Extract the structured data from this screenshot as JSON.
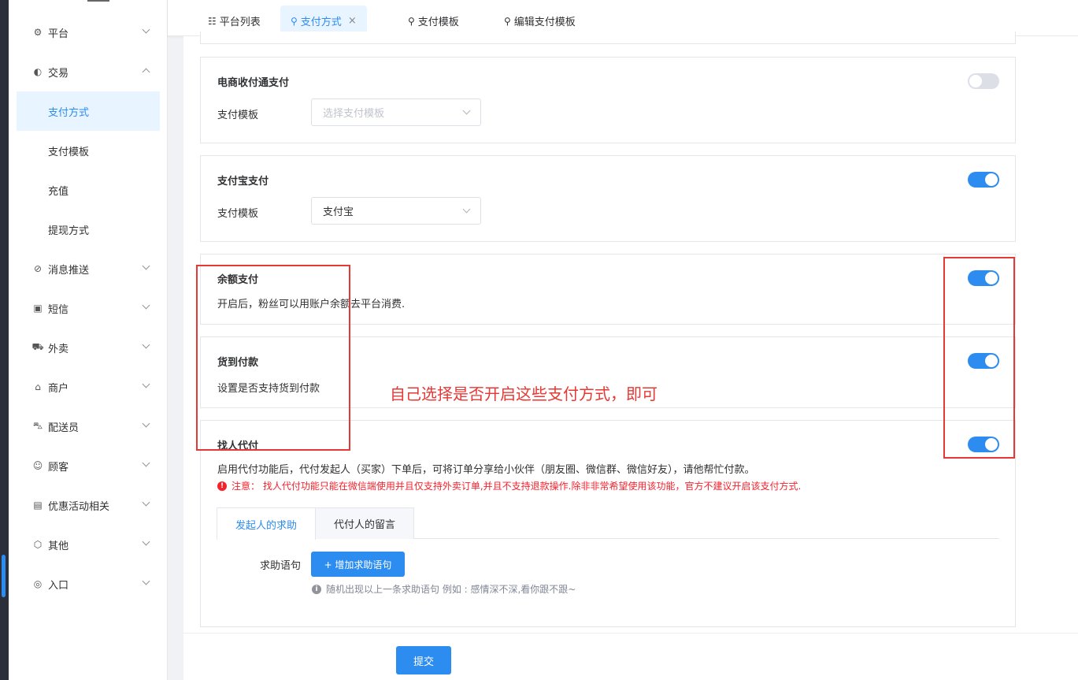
{
  "sidebar": {
    "items": [
      {
        "label": "平台",
        "icon": "gear-icon",
        "expanded": false
      },
      {
        "label": "交易",
        "icon": "wallet-icon",
        "expanded": true,
        "children": [
          "支付方式",
          "支付模板",
          "充值",
          "提现方式"
        ],
        "active_child": "支付方式"
      },
      {
        "label": "消息推送",
        "icon": "bell-off-icon",
        "expanded": false
      },
      {
        "label": "短信",
        "icon": "chat-icon",
        "expanded": false
      },
      {
        "label": "外卖",
        "icon": "scooter-icon",
        "expanded": false
      },
      {
        "label": "商户",
        "icon": "store-icon",
        "expanded": false
      },
      {
        "label": "配送员",
        "icon": "delivery-icon",
        "expanded": false
      },
      {
        "label": "顾客",
        "icon": "user-circle-icon",
        "expanded": false
      },
      {
        "label": "优惠活动相关",
        "icon": "gift-icon",
        "expanded": false
      },
      {
        "label": "其他",
        "icon": "hexagon-icon",
        "expanded": false
      },
      {
        "label": "入口",
        "icon": "compass-icon",
        "expanded": false
      }
    ]
  },
  "tabs": [
    {
      "label": "平台列表",
      "icon": "list-icon",
      "active": false
    },
    {
      "label": "支付方式",
      "icon": "user-gear-icon",
      "active": true,
      "closable": true,
      "close_glyph": "×"
    },
    {
      "label": "支付模板",
      "icon": "user-gear-icon",
      "active": false
    },
    {
      "label": "编辑支付模板",
      "icon": "user-gear-icon",
      "active": false
    }
  ],
  "cards": {
    "ecommerce": {
      "title": "电商收付通支付",
      "template_label": "支付模板",
      "select_placeholder": "选择支付模板",
      "enabled": false
    },
    "alipay": {
      "title": "支付宝支付",
      "template_label": "支付模板",
      "select_value": "支付宝",
      "enabled": true
    },
    "balance": {
      "title": "余额支付",
      "desc": "开启后，粉丝可以用账户余额去平台消费.",
      "enabled": true
    },
    "cod": {
      "title": "货到付款",
      "desc": "设置是否支持货到付款",
      "enabled": true
    },
    "proxy": {
      "title": "找人代付",
      "desc": "启用代付功能后，代付发起人（买家）下单后，可将订单分享给小伙伴（朋友圈、微信群、微信好友），请他帮忙付款。",
      "warning": "注意：  找人代付功能只能在微信端使用并且仅支持外卖订单,并且不支持退款操作.除非非常希望使用该功能，官方不建议开启该支付方式.",
      "enabled": true,
      "inner_tabs": [
        "发起人的求助",
        "代付人的留言"
      ],
      "help_label": "求助语句",
      "add_button": "+ 增加求助语句",
      "tip": "随机出现以上一条求助语句 例如 : 感情深不深,看你跟不跟~"
    }
  },
  "submit_label": "提交",
  "annotation": "自己选择是否开启这些支付方式，即可",
  "colors": {
    "accent": "#2d8cf0",
    "annotation": "#e53935",
    "warning": "#f5222d"
  }
}
